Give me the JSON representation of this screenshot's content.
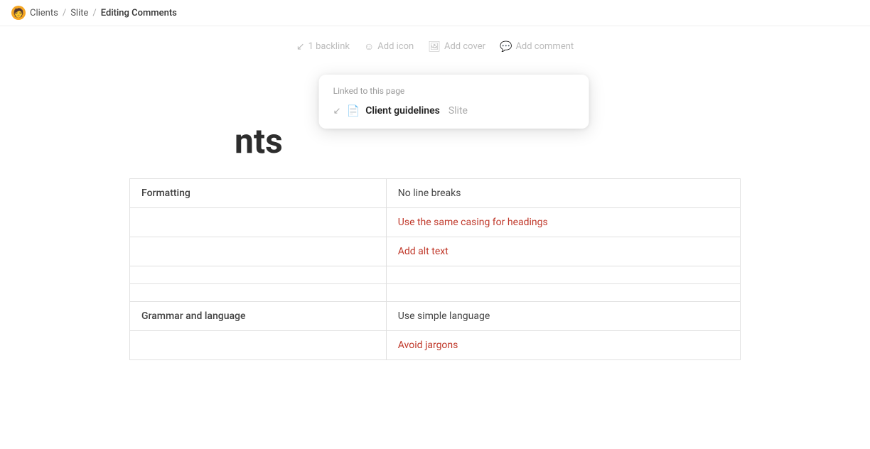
{
  "breadcrumb": {
    "avatar": "🧑",
    "items": [
      "Clients",
      "Slite",
      "Editing Comments"
    ]
  },
  "toolbar": {
    "backlink_label": "1 backlink",
    "add_icon_label": "Add icon",
    "add_cover_label": "Add cover",
    "add_comment_label": "Add comment"
  },
  "backlink_popup": {
    "title": "Linked to this page",
    "items": [
      {
        "name": "Client guidelines",
        "workspace": "Slite"
      }
    ]
  },
  "page_title_partial": "nts",
  "table": {
    "rows": [
      {
        "col1": "Formatting",
        "col2": "No line breaks",
        "col2_type": "text"
      },
      {
        "col1": "",
        "col2": "Use the same casing for headings",
        "col2_type": "link"
      },
      {
        "col1": "",
        "col2": "Add alt text",
        "col2_type": "link"
      },
      {
        "col1": "",
        "col2": "",
        "col2_type": "empty"
      },
      {
        "col1": "",
        "col2": "",
        "col2_type": "empty"
      },
      {
        "col1": "Grammar and language",
        "col2": "Use simple language",
        "col2_type": "text"
      },
      {
        "col1": "",
        "col2": "Avoid jargons",
        "col2_type": "link"
      }
    ]
  }
}
